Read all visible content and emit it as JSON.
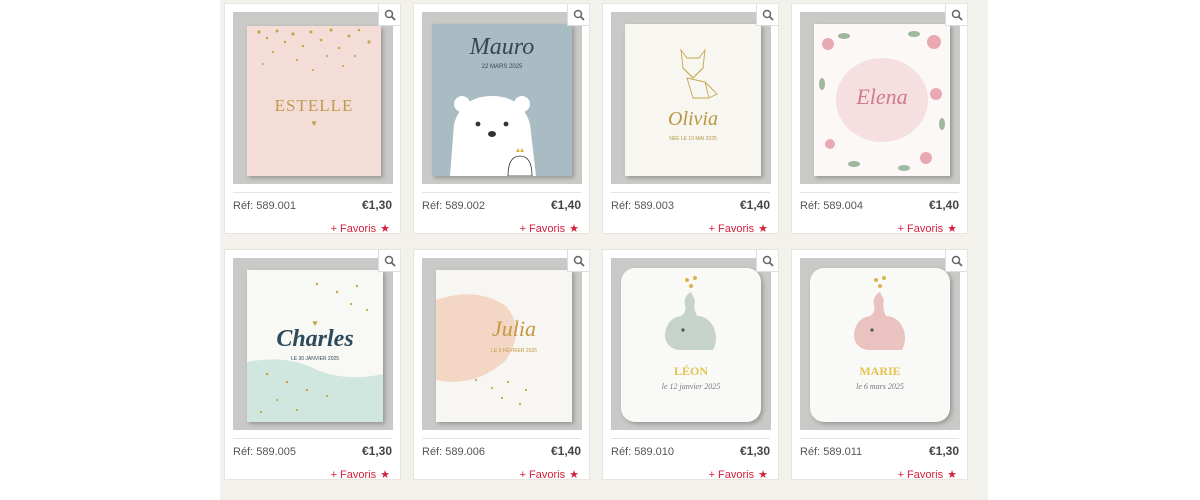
{
  "products": [
    {
      "ref": "Réf: 589.001",
      "price": "€1,30",
      "favoris": "+ Favoris",
      "card_text": "ESTELLE"
    },
    {
      "ref": "Réf: 589.002",
      "price": "€1,40",
      "favoris": "+ Favoris",
      "card_text": "Mauro",
      "card_date": "22 MARS 2025"
    },
    {
      "ref": "Réf: 589.003",
      "price": "€1,40",
      "favoris": "+ Favoris",
      "card_text": "Olivia",
      "card_date": "NÉE LE 10 MAI 2025"
    },
    {
      "ref": "Réf: 589.004",
      "price": "€1,40",
      "favoris": "+ Favoris",
      "card_text": "Elena"
    },
    {
      "ref": "Réf: 589.005",
      "price": "€1,30",
      "favoris": "+ Favoris",
      "card_text": "Charles",
      "card_date": "LE 30 JANVIER 2025"
    },
    {
      "ref": "Réf: 589.006",
      "price": "€1,40",
      "favoris": "+ Favoris",
      "card_text": "Julia",
      "card_date": "LE 5 FÉVRIER 2025"
    },
    {
      "ref": "Réf: 589.010",
      "price": "€1,30",
      "favoris": "+ Favoris",
      "card_text": "LÉON",
      "card_date": "le 12 janvier 2025"
    },
    {
      "ref": "Réf: 589.011",
      "price": "€1,30",
      "favoris": "+ Favoris",
      "card_text": "MARIE",
      "card_date": "le 6 mars 2025"
    }
  ],
  "colors": {
    "favoris": "#d4213d",
    "panel_bg": "#f2f1ec",
    "gold": "#c7a64a"
  },
  "icons": {
    "zoom": "magnifier-icon",
    "favoris": "star-icon"
  }
}
